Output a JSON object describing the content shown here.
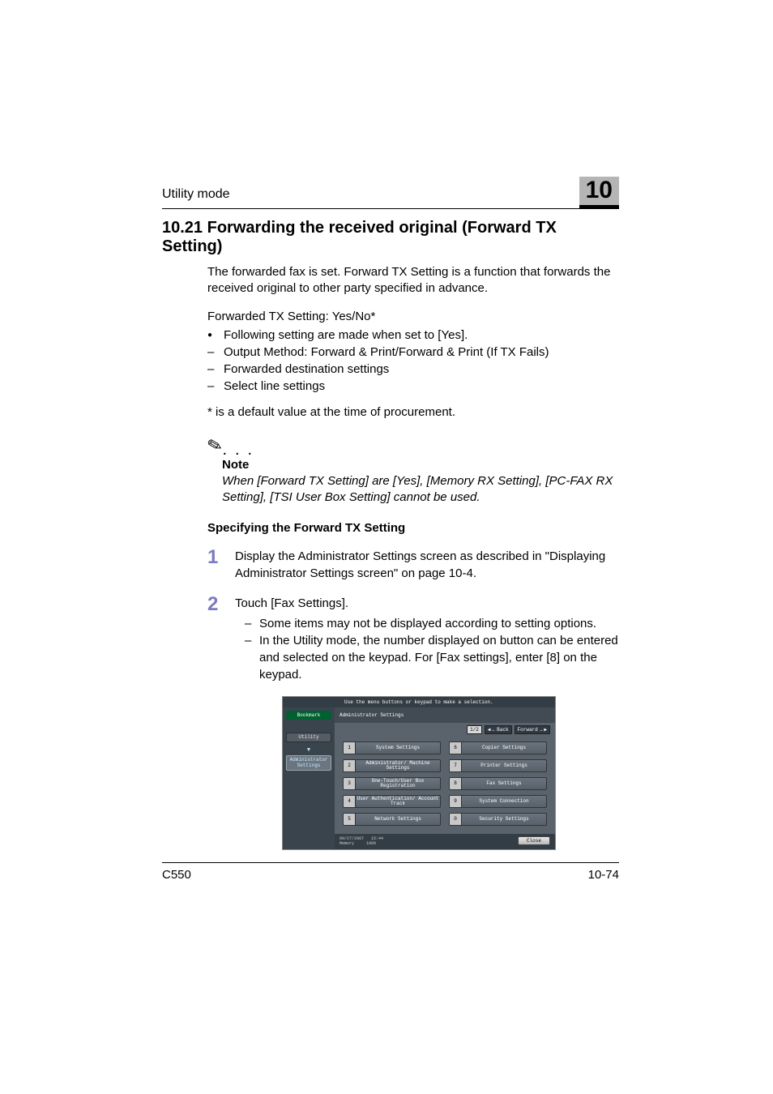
{
  "running_head": "Utility mode",
  "chapter_number": "10",
  "section_title": "10.21 Forwarding the received original (Forward TX Setting)",
  "intro_paragraph": "The forwarded fax is set. Forward TX Setting is a function that forwards the received original to other party specified in advance.",
  "setting_summary": "Forwarded TX Setting: Yes/No*",
  "setting_items": [
    {
      "kind": "bullet",
      "text": "Following setting are made when set to [Yes]."
    },
    {
      "kind": "dash",
      "text": "Output Method: Forward & Print/Forward & Print (If TX Fails)"
    },
    {
      "kind": "dash",
      "text": "Forwarded destination settings"
    },
    {
      "kind": "dash",
      "text": "Select line settings"
    }
  ],
  "footnote": "* is a default value at the time of procurement.",
  "note": {
    "label": "Note",
    "body": "When [Forward TX Setting] are [Yes], [Memory RX Setting], [PC-FAX RX Setting], [TSI User Box Setting] cannot be used."
  },
  "subhead": "Specifying the Forward TX Setting",
  "steps": [
    {
      "num": "1",
      "text": "Display the Administrator Settings screen as described in \"Displaying Administrator Settings screen\" on page 10-4.",
      "sub": []
    },
    {
      "num": "2",
      "text": "Touch [Fax Settings].",
      "sub": [
        "Some items may not be displayed according to setting options.",
        "In the Utility mode, the number displayed on button can be entered and selected on the keypad. For [Fax settings], enter [8] on the keypad."
      ]
    }
  ],
  "screen": {
    "top_message": "Use the menu buttons or keypad to make a selection.",
    "bookmark": "Bookmark",
    "side_utility": "Utility",
    "side_admin": "Administrator Settings",
    "title": "Administrator Settings",
    "pager": "1/2",
    "back": "Back",
    "forward": "Forward",
    "menu": [
      {
        "n": "1",
        "label": "System Settings"
      },
      {
        "n": "2",
        "label": "Administrator/ Machine Settings"
      },
      {
        "n": "3",
        "label": "One-Touch/User Box Registration"
      },
      {
        "n": "4",
        "label": "User Authentication/ Account Track"
      },
      {
        "n": "5",
        "label": "Network Settings"
      },
      {
        "n": "6",
        "label": "Copier Settings"
      },
      {
        "n": "7",
        "label": "Printer Settings"
      },
      {
        "n": "8",
        "label": "Fax Settings"
      },
      {
        "n": "9",
        "label": "System Connection"
      },
      {
        "n": "0",
        "label": "Security Settings"
      }
    ],
    "footer_date": "09/27/2007",
    "footer_time": "15:44",
    "footer_mem_label": "Memory",
    "footer_mem_val": "100%",
    "close": "Close"
  },
  "footer_model": "C550",
  "footer_page": "10-74"
}
